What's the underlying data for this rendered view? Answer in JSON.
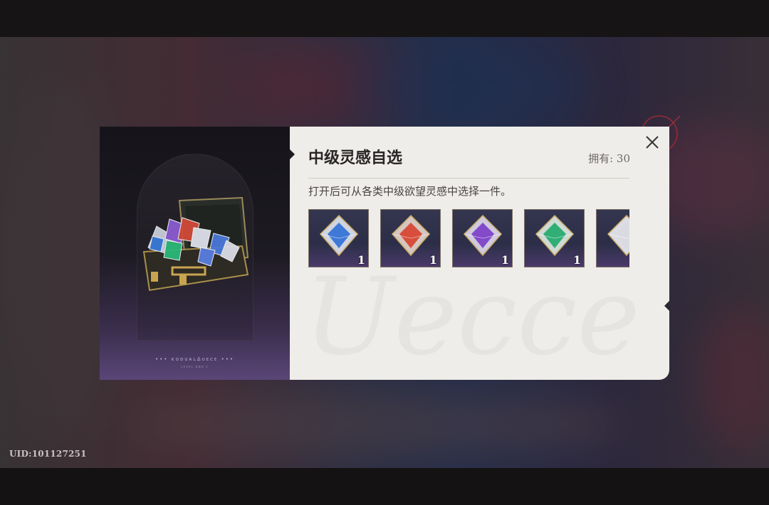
{
  "user": {
    "uid": "UID:101127251"
  },
  "dialog": {
    "title": "中级灵感自选",
    "owned": "拥有: 30",
    "description": "打开后可从各类中级欲望灵感中选择一件。",
    "brand_text": "••• ĸᴏᴅᴜᴀʟ∆ᴜᴇᴄᴇ •••",
    "brand_sub": "ʟᴇᴠᴇʟ ᴀɴᴅ ᴄ",
    "watermark": "Uecce",
    "items": [
      {
        "name": "blue",
        "color": "#2f6fd6",
        "quantity": "1"
      },
      {
        "name": "red",
        "color": "#d8402e",
        "quantity": "1"
      },
      {
        "name": "purple",
        "color": "#7a3cc8",
        "quantity": "1"
      },
      {
        "name": "green",
        "color": "#1fa86a",
        "quantity": "1"
      },
      {
        "name": "white",
        "color": "#d9d9e0",
        "quantity": ""
      }
    ]
  },
  "icons": {
    "close": "close-icon",
    "chest": "gem-chest-icon"
  }
}
